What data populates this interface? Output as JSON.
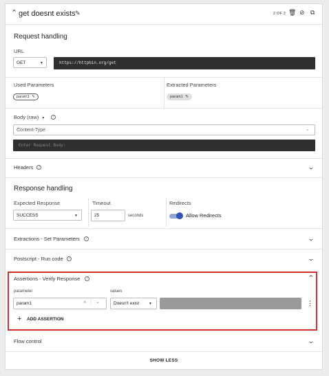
{
  "header": {
    "title": "get doesnt exists",
    "page_indicator": "2 OF 2"
  },
  "request": {
    "title": "Request handling",
    "url_label": "URL",
    "method": "GET",
    "url": "https://httpbin.org/get",
    "used_params_label": "Used Parameters",
    "used_param_chip": "param1",
    "extracted_params_label": "Extracted Parameters",
    "extracted_param_chip": "param1",
    "body_label": "Body (raw)",
    "content_type_placeholder": "Content-Type",
    "body_placeholder": "Enter Request Body:",
    "headers_label": "Headers"
  },
  "response": {
    "title": "Response handling",
    "expected_label": "Expected Response",
    "expected_value": "SUCCESS",
    "timeout_label": "Timeout",
    "timeout_value": "25",
    "timeout_unit": "seconds",
    "redirects_label": "Redirects",
    "allow_redirects": "Allow Redirects"
  },
  "sections": {
    "extractions": "Extractions - Set Parameters",
    "postscript": "Postscript - Run code",
    "assertions": "Assertions - Verify Response",
    "flow_control": "Flow control"
  },
  "assertions": {
    "parameter_label": "parameter",
    "values_label": "values",
    "param_value": "param1",
    "operator": "Doesn't exist",
    "add_label": "ADD ASSERTION"
  },
  "footer": {
    "show_less": "SHOW LESS"
  },
  "colors": {
    "accent": "#3452b4",
    "highlight_border": "#d32f2f",
    "dark_input": "#2f2f2f"
  }
}
